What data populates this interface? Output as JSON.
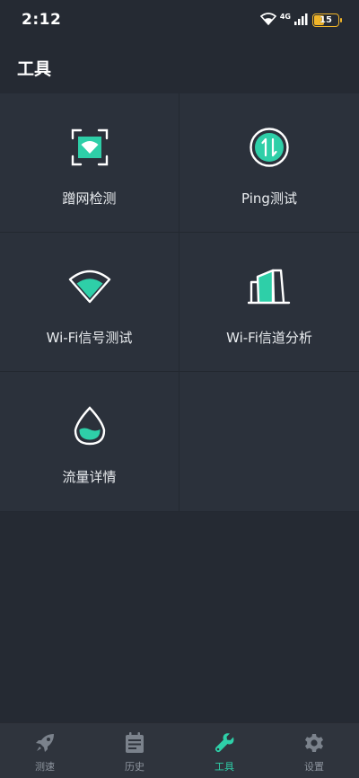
{
  "status_bar": {
    "time": "2:12",
    "network_label": "4G",
    "battery_level": "15",
    "icons": [
      "wifi-icon",
      "signal-icon",
      "battery-icon"
    ]
  },
  "header": {
    "title": "工具"
  },
  "tools": [
    {
      "label": "蹭网检测",
      "icon": "scan-wifi-icon"
    },
    {
      "label": "Ping测试",
      "icon": "ping-arrows-icon"
    },
    {
      "label": "Wi-Fi信号测试",
      "icon": "wifi-signal-icon"
    },
    {
      "label": "Wi-Fi信道分析",
      "icon": "channel-bars-icon"
    },
    {
      "label": "流量详情",
      "icon": "drop-icon"
    }
  ],
  "bottom_nav": {
    "items": [
      {
        "label": "测速",
        "icon": "rocket-icon"
      },
      {
        "label": "历史",
        "icon": "calendar-icon"
      },
      {
        "label": "工具",
        "icon": "wrench-icon",
        "active": true
      },
      {
        "label": "设置",
        "icon": "gear-icon"
      }
    ]
  },
  "colors": {
    "accent": "#2ecfa8",
    "background": "#252a33",
    "tile_background": "#2b313b",
    "nav_background": "#2f343d",
    "battery": "#f0b429"
  }
}
